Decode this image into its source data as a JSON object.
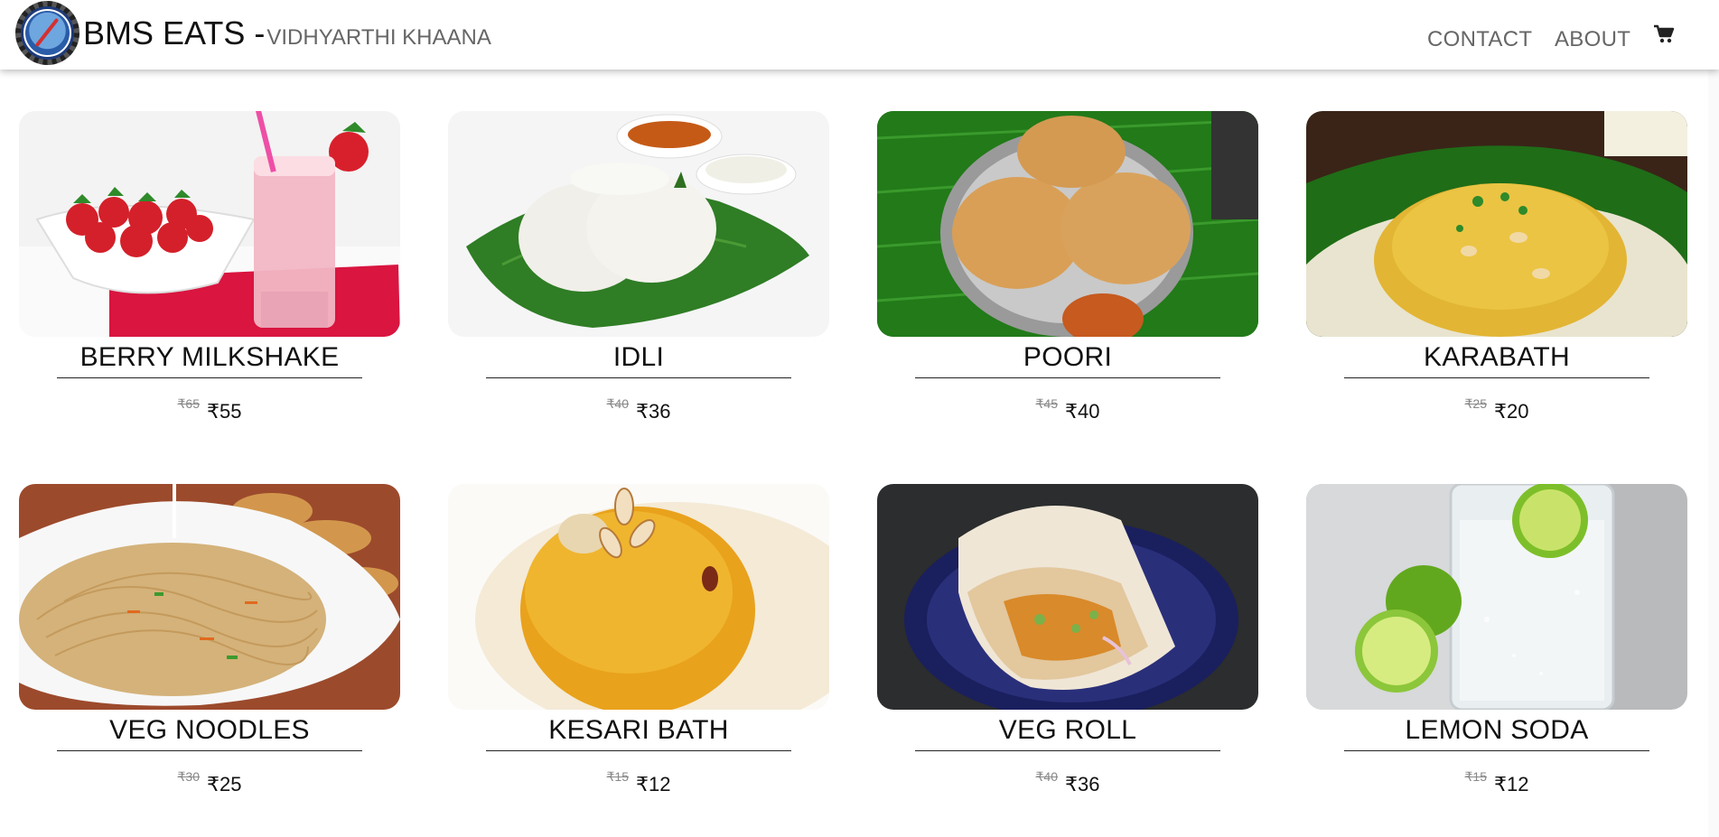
{
  "navbar": {
    "brand_main": "BMS EATS -",
    "brand_sub": "VIDHYARTHI KHAANA",
    "links": [
      "CONTACT",
      "ABOUT"
    ],
    "cart_icon": "shopping-cart-icon",
    "logo_icon": "college-emblem-logo"
  },
  "menu": {
    "currency": "₹",
    "items": [
      {
        "name": "BERRY MILKSHAKE",
        "old_price": "₹65",
        "price": "₹55",
        "image": "berry-milkshake-photo"
      },
      {
        "name": "IDLI",
        "old_price": "₹40",
        "price": "₹36",
        "image": "idli-photo"
      },
      {
        "name": "POORI",
        "old_price": "₹45",
        "price": "₹40",
        "image": "poori-photo"
      },
      {
        "name": "KARABATH",
        "old_price": "₹25",
        "price": "₹20",
        "image": "karabath-photo"
      },
      {
        "name": "VEG NOODLES",
        "old_price": "₹30",
        "price": "₹25",
        "image": "veg-noodles-photo"
      },
      {
        "name": "KESARI BATH",
        "old_price": "₹15",
        "price": "₹12",
        "image": "kesari-bath-photo"
      },
      {
        "name": "VEG ROLL",
        "old_price": "₹40",
        "price": "₹36",
        "image": "veg-roll-photo"
      },
      {
        "name": "LEMON SODA",
        "old_price": "₹15",
        "price": "₹12",
        "image": "lemon-soda-photo"
      }
    ]
  },
  "colors": {
    "text": "#111111",
    "muted": "#666666",
    "strike": "#888888",
    "banana_leaf": "#2e7d23",
    "kesari": "#e9a21c",
    "karabath": "#e3b53a"
  }
}
